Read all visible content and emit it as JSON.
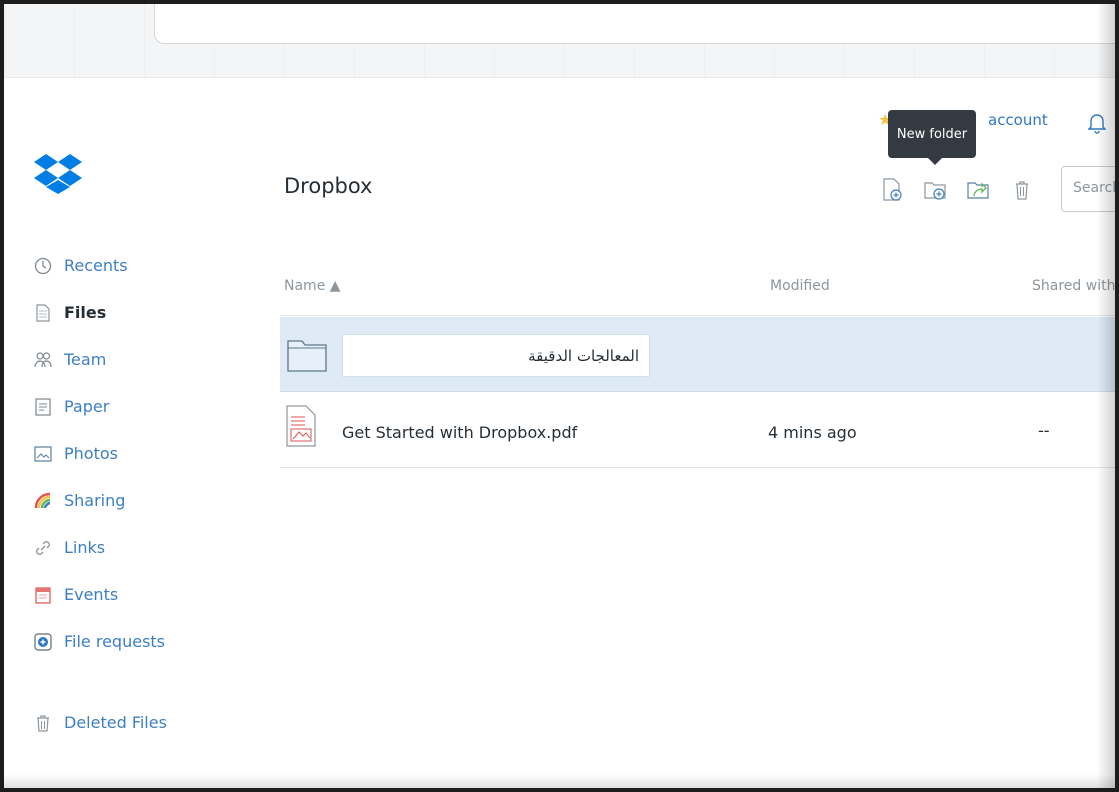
{
  "header": {
    "account_label": "account",
    "tooltip": "New folder"
  },
  "page": {
    "title": "Dropbox",
    "search_placeholder": "Search"
  },
  "sidebar": {
    "items": [
      {
        "label": "Recents",
        "icon": "clock-icon"
      },
      {
        "label": "Files",
        "icon": "files-icon",
        "active": true
      },
      {
        "label": "Team",
        "icon": "team-icon"
      },
      {
        "label": "Paper",
        "icon": "paper-icon"
      },
      {
        "label": "Photos",
        "icon": "photos-icon"
      },
      {
        "label": "Sharing",
        "icon": "sharing-icon"
      },
      {
        "label": "Links",
        "icon": "link-icon"
      },
      {
        "label": "Events",
        "icon": "events-icon"
      },
      {
        "label": "File requests",
        "icon": "file-requests-icon"
      }
    ],
    "deleted_label": "Deleted Files"
  },
  "table": {
    "columns": [
      "Name ▲",
      "Modified",
      "Shared with"
    ],
    "new_folder_value": "المعالجات الدقيقة",
    "rows": [
      {
        "name": "Get Started with Dropbox.pdf",
        "modified": "4 mins ago",
        "shared": "--"
      }
    ]
  },
  "colors": {
    "accent": "#3d7fc4",
    "selected_row": "#deebf7",
    "dropbox_blue": "#007ee5"
  }
}
